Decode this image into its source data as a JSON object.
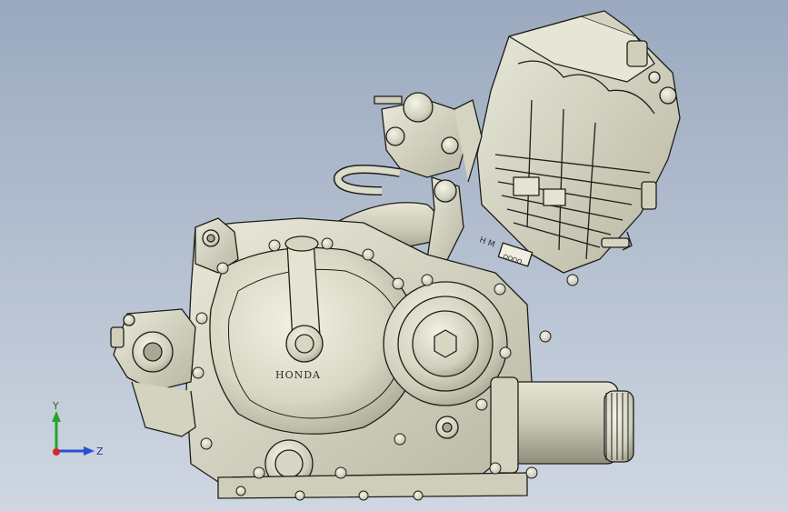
{
  "model": {
    "brand_text": "HONDA",
    "head_mark": "H M",
    "head_plate": "ΩΩΩΩ"
  },
  "triad": {
    "y_label": "Y",
    "z_label": "Z"
  },
  "colors": {
    "background_top": "#9aa9bf",
    "background_bottom": "#cfd7e2",
    "metal": "#dcdccb",
    "metal_shade": "#b9b8a3",
    "edge": "#1e1e1a",
    "axis_y": "#2aa02a",
    "axis_z": "#2a4fd6",
    "axis_x": "#d62a2a"
  }
}
